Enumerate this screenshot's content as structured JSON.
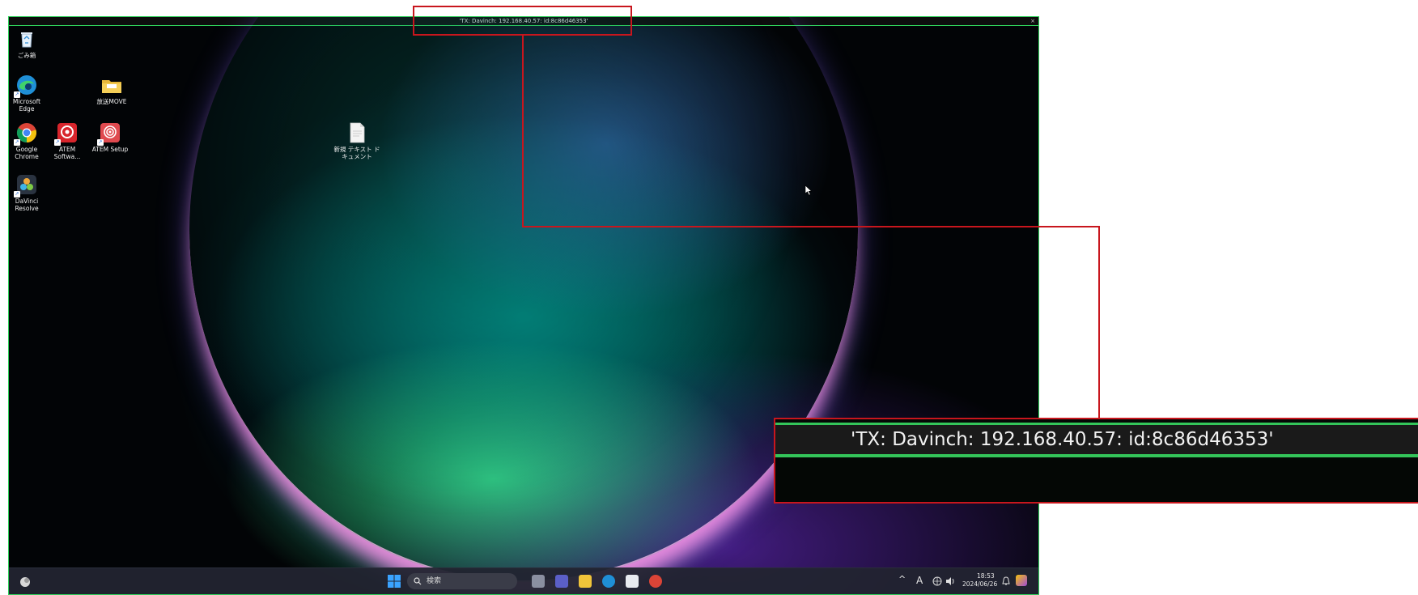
{
  "window": {
    "title": "'TX: Davinch: 192.168.40.57: id:8c86d46353'",
    "close_glyph": "×"
  },
  "desktop_icons": [
    {
      "label": "ごみ箱",
      "icon": "recycle-bin-icon"
    },
    {
      "label": "Microsoft Edge",
      "icon": "edge-icon"
    },
    {
      "label": "放送MOVE",
      "icon": "folder-icon"
    },
    {
      "label": "Google Chrome",
      "icon": "chrome-icon"
    },
    {
      "label": "ATEM Softwa...",
      "icon": "atem-software-icon"
    },
    {
      "label": "ATEM Setup",
      "icon": "atem-setup-icon"
    },
    {
      "label": "新規 テキスト ドキュメント",
      "icon": "text-document-icon"
    },
    {
      "label": "DaVinci Resolve",
      "icon": "davinci-resolve-icon"
    }
  ],
  "taskbar": {
    "search_label": "検索",
    "ime_indicator": "A",
    "time": "18:53",
    "date": "2024/06/26"
  },
  "callout": {
    "zoomed_title": "'TX: Davinch: 192.168.40.57: id:8c86d46353'"
  },
  "colors": {
    "highlight": "#c8161d",
    "window_border": "#2fd05a"
  }
}
